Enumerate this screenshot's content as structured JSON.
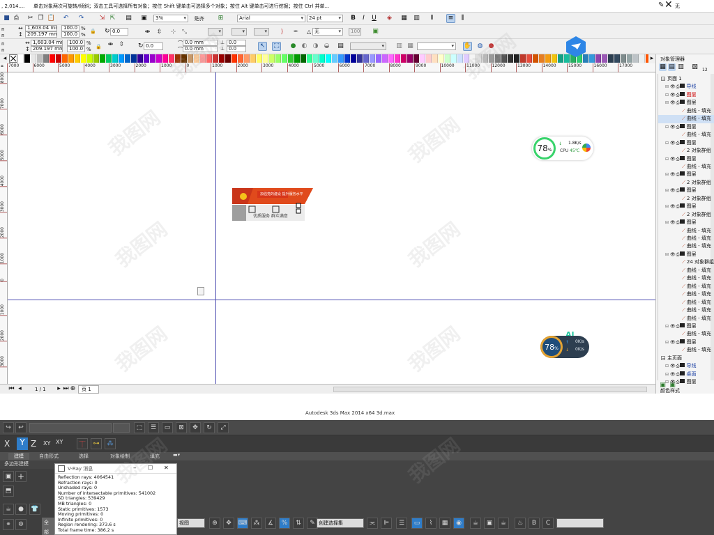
{
  "statusbar": {
    "coords": ", 2,014....",
    "hint": "单击对象两次可旋转/倾斜；双击工具可选择所有对象；按住 Shift 键单击可选择多个对象；按住 Alt 键单击可进行挖掘；按住 Ctrl 并单...",
    "right_text": "无"
  },
  "toolbar": {
    "zoom": "3%",
    "snap": "贴齐",
    "font_name": "Arial",
    "font_size": "24 pt",
    "outline": "无",
    "percent_small": "100"
  },
  "propbar1": {
    "x": "n",
    "y": "n",
    "width": "1,603.04 mm",
    "height": "209.197 mm",
    "scale_w": "100.0",
    "scale_h": "100.0",
    "pct": "%",
    "angle": "0.0"
  },
  "propbar2": {
    "x": "n",
    "y": "n",
    "width": "1,603.04 mm",
    "height": "209.197 mm",
    "scale_w": "100.0",
    "scale_h": "100.0",
    "pct": "%",
    "angle": "0.0",
    "pos1": "0.0 mm",
    "pos2": "0.0 mm",
    "offset1": "0.0",
    "offset2": "0.0"
  },
  "ruler": {
    "h_ticks": [
      "7000",
      "6000",
      "5000",
      "4000",
      "3000",
      "2000",
      "1000",
      "0",
      "1000",
      "2000",
      "3000",
      "4000",
      "5000",
      "6000",
      "7000",
      "8000",
      "9000",
      "10000",
      "11000",
      "12000",
      "13000",
      "14000",
      "15000",
      "16000",
      "17000"
    ],
    "v_ticks": [
      "8000",
      "7000",
      "6000",
      "5000",
      "4000",
      "3000",
      "2000",
      "1000",
      "0",
      "1000",
      "2000",
      "3000"
    ]
  },
  "palette": {
    "colors": [
      "#ffffff",
      "#000000",
      "#e8e8e8",
      "#c0c0c0",
      "#808080",
      "#ff0000",
      "#cc0000",
      "#ff6600",
      "#ff9900",
      "#ffcc00",
      "#ffff00",
      "#ccff00",
      "#99cc00",
      "#00aa00",
      "#00cc66",
      "#00cccc",
      "#0099ff",
      "#0066cc",
      "#003399",
      "#330099",
      "#6600cc",
      "#9900cc",
      "#cc00cc",
      "#ff0099",
      "#ff3366",
      "#993300",
      "#663300",
      "#cc9966",
      "#ffcc99",
      "#ff9999",
      "#ff6666",
      "#cc3333",
      "#990000",
      "#660000",
      "#ff3300",
      "#ff6633",
      "#ff9966",
      "#ffcc66",
      "#ffff66",
      "#ffff99",
      "#ccff66",
      "#99ff66",
      "#66ff66",
      "#33cc33",
      "#009900",
      "#006600",
      "#33ff99",
      "#66ffcc",
      "#00ffcc",
      "#00ffff",
      "#66ccff",
      "#3399ff",
      "#0033cc",
      "#000099",
      "#333399",
      "#6666cc",
      "#9999ff",
      "#9966ff",
      "#cc66ff",
      "#ff66ff",
      "#ff33cc",
      "#cc0066",
      "#990066",
      "#660033",
      "#ffccff",
      "#ffcccc",
      "#ffe0c0",
      "#ffffcc",
      "#ccffcc",
      "#ccffff",
      "#cce0ff",
      "#e0ccff",
      "#f4f4f4",
      "#dddddd",
      "#bbbbbb",
      "#999999",
      "#777777",
      "#555555",
      "#333333",
      "#222222",
      "#c0392b",
      "#e74c3c",
      "#d35400",
      "#e67e22",
      "#f39c12",
      "#f1c40f",
      "#16a085",
      "#1abc9c",
      "#27ae60",
      "#2ecc71",
      "#2980b9",
      "#3498db",
      "#8e44ad",
      "#9b59b6",
      "#2c3e50",
      "#34495e",
      "#7f8c8d",
      "#95a5a6",
      "#bdc3c7",
      "#ecf0f1",
      "#ff5500",
      "#aa0000",
      "#00aaff",
      "#ffaa00"
    ]
  },
  "page_nav": {
    "counter": "1 / 1",
    "tab": "页 1"
  },
  "object_manager": {
    "title": "对象管理器",
    "count": "12",
    "items": [
      "页面 1",
      "导线",
      "图层",
      "图层",
      "曲线 - 填充",
      "曲线 - 填充",
      "图层",
      "曲线 - 填充",
      "图层",
      "2 对象群组",
      "图层",
      "曲线 - 填充",
      "图层",
      "2 对象群组",
      "图层",
      "2 对象群组",
      "图层",
      "2 对象群组",
      "图层",
      "曲线 - 填充",
      "曲线 - 填充",
      "曲线 - 填充",
      "图层",
      "24 对象群组",
      "曲线 - 填充",
      "曲线 - 填充",
      "曲线 - 填充",
      "曲线 - 填充",
      "曲线 - 填充",
      "曲线 - 填充",
      "曲线 - 填充",
      "图层",
      "曲线 - 填充",
      "图层",
      "曲线 - 填充",
      "主页面",
      "导线",
      "桌面",
      "图层"
    ],
    "footer": "颜色样式"
  },
  "design_thumb": {
    "banner_text": "加强党的建设 提升服务水平",
    "sub_text": "优质服务 群众满意"
  },
  "widget_cpu": {
    "percent": "78",
    "percent_sign": "%",
    "net": "1.8K/s",
    "cpu": "CPU",
    "temp": "45℃"
  },
  "widget_net": {
    "ai": "AI",
    "percent": "78",
    "percent_sign": "%",
    "up": "0K/s",
    "down": "0K/s"
  },
  "max_title": "Autodesk 3ds Max  2014 x64    3d.max",
  "max": {
    "axes": [
      "X",
      "Y",
      "Z",
      "XY",
      "XY"
    ],
    "tabs": [
      "建模",
      "自由形式",
      "选择",
      "对象绘制",
      "填充"
    ],
    "subtab": "多边形建模",
    "all": "全部",
    "view": "视图",
    "selection_set": "创建选择集"
  },
  "vray": {
    "title": "V-Ray 消息",
    "lines": [
      "Reflection rays: 4064541",
      "Refraction rays: 0",
      "Unshaded rays: 0",
      "Number of intersectable primitives: 541002",
      "SD triangles: 539429",
      "MB triangles: 0",
      "Static primitives: 1573",
      "Moving primitives: 0",
      "Infinite primitives: 0",
      "Region rendering: 373.6 s",
      "Total frame time: 386.2 s"
    ]
  },
  "watermark": "我图网"
}
